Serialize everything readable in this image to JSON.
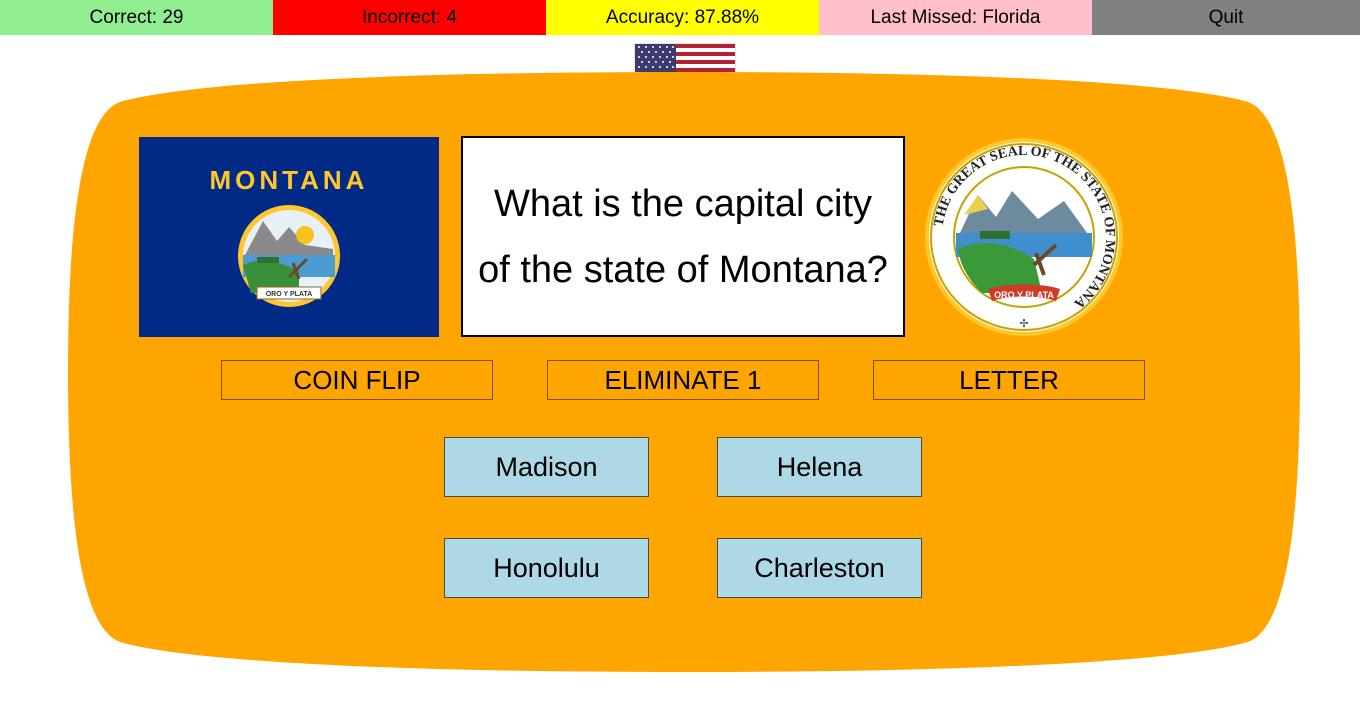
{
  "stats": {
    "correct": "Correct: 29",
    "incorrect": "Incorrect: 4",
    "accuracy": "Accuracy: 87.88%",
    "last_missed": "Last Missed: Florida",
    "quit_label": "Quit"
  },
  "colors": {
    "correct_bg": "#90EE90",
    "incorrect_bg": "#FF0000",
    "accuracy_bg": "#FFFF00",
    "last_missed_bg": "#FFC0CB",
    "quit_bg": "#808080",
    "board_bg": "#FFA500",
    "answer_bg": "#ADD8E6",
    "flag_blue": "#002A86"
  },
  "question": {
    "text": "What is the capital city of the state of Montana?"
  },
  "state_flag": {
    "banner_text": "MONTANA",
    "motto": "ORO Y PLATA"
  },
  "seal": {
    "ring_text": "THE GREAT SEAL OF THE STATE OF MONTANA",
    "motto": "ORO Y PLATA"
  },
  "lifelines": {
    "coin_flip": "COIN FLIP",
    "eliminate": "ELIMINATE 1",
    "letter": "LETTER"
  },
  "answers": [
    "Madison",
    "Helena",
    "Honolulu",
    "Charleston"
  ]
}
